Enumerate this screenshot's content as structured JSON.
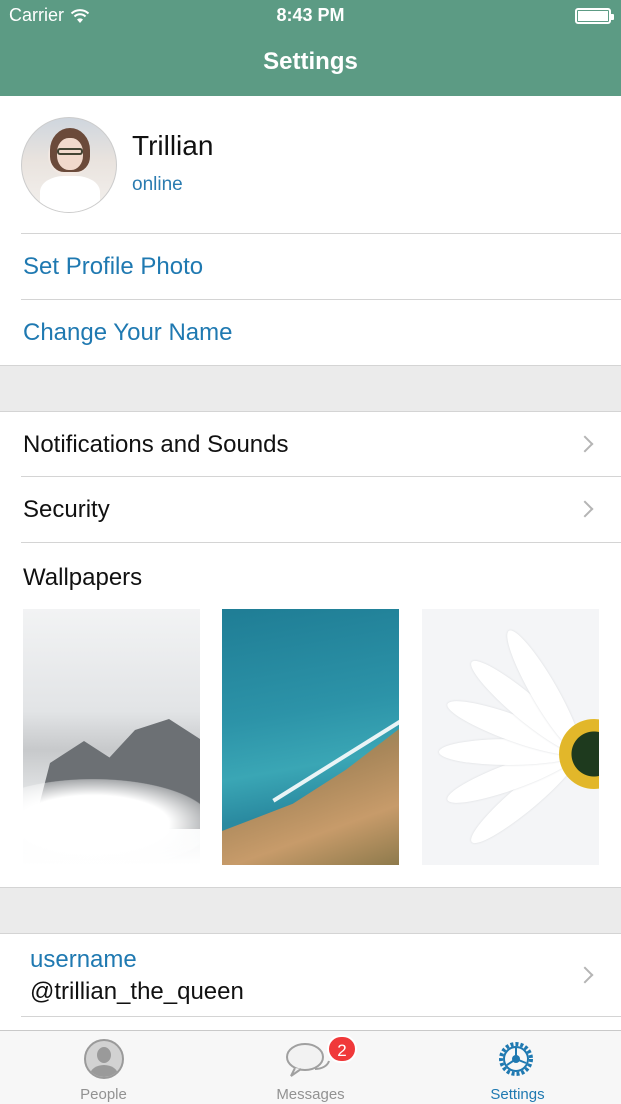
{
  "status_bar": {
    "carrier": "Carrier",
    "time": "8:43 PM"
  },
  "nav": {
    "title": "Settings"
  },
  "profile": {
    "name": "Trillian",
    "status": "online"
  },
  "profile_actions": {
    "set_photo": "Set Profile Photo",
    "change_name": "Change Your Name"
  },
  "menu": {
    "notifications": "Notifications and Sounds",
    "security": "Security"
  },
  "wallpapers": {
    "title": "Wallpapers",
    "items": [
      "mountain-mist",
      "ocean-coast",
      "white-daisy"
    ]
  },
  "username": {
    "label": "username",
    "value": "@trillian_the_queen"
  },
  "tabbar": {
    "people": "People",
    "messages": "Messages",
    "messages_badge": "2",
    "settings": "Settings",
    "active": "Settings"
  },
  "colors": {
    "nav": "#5c9b84",
    "link": "#1f79b1",
    "badge": "#f0393a"
  }
}
